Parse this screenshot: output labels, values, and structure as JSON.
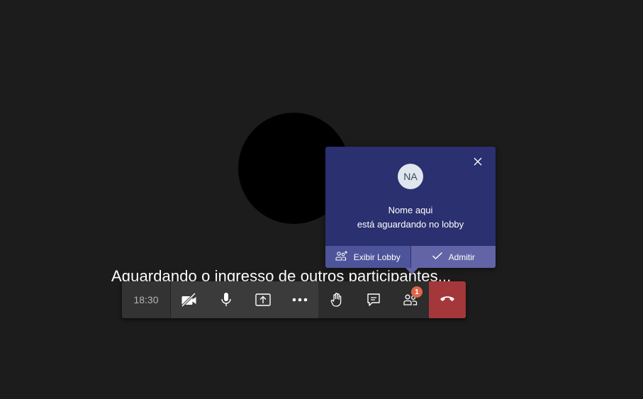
{
  "stage": {
    "waiting_message": "Aguardando o ingresso de outros participantes..."
  },
  "call_bar": {
    "timer": "18:30",
    "icons": [
      "camera-off-icon",
      "mic-icon",
      "share-screen-icon",
      "more-icon",
      "raise-hand-icon",
      "chat-icon",
      "participants-icon",
      "hang-up-icon"
    ],
    "participants_badge": "1"
  },
  "lobby_popup": {
    "initials": "NA",
    "name_line": "Nome aqui",
    "status_line": "está aguardando no lobby",
    "view_lobby_label": "Exibir Lobby",
    "admit_label": "Admitir"
  },
  "colors": {
    "background": "#1c1c1c",
    "popup_background": "#2b3070",
    "popup_accent": "#6264a7",
    "hang_up": "#a4373a",
    "badge": "#e0664a"
  }
}
